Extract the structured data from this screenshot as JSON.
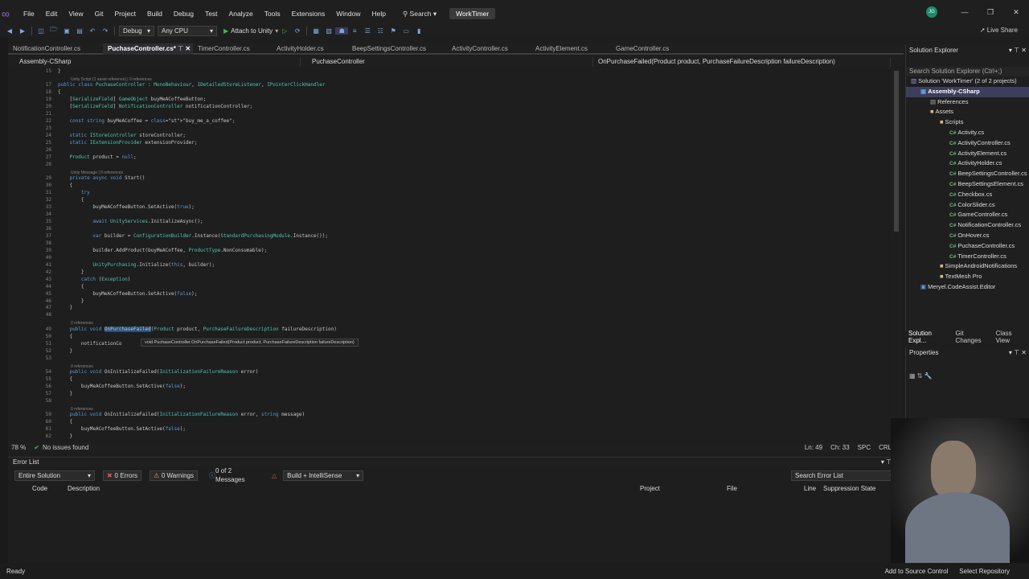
{
  "menu": [
    "File",
    "Edit",
    "View",
    "Git",
    "Project",
    "Build",
    "Debug",
    "Test",
    "Analyze",
    "Tools",
    "Extensions",
    "Window",
    "Help"
  ],
  "search_label": "Search",
  "project_name": "WorkTimer",
  "user_initials": "JG",
  "toolbar": {
    "config": "Debug",
    "platform": "Any CPU",
    "attach": "Attach to Unity",
    "live_share": "Live Share"
  },
  "tabs": [
    "NotificationController.cs",
    "PuchaseController.cs*",
    "TimerController.cs",
    "ActivityHolder.cs",
    "BeepSettingsController.cs",
    "ActivityController.cs",
    "ActivityElement.cs",
    "GameController.cs"
  ],
  "nav": {
    "project": "Assembly-CSharp",
    "class": "PuchaseController",
    "member": "OnPurchaseFailed(Product product, PurchaseFailureDescription failureDescription)"
  },
  "code_lines": [
    {
      "n": "15",
      "t": "}"
    },
    {
      "n": "",
      "hint": "Unity Script (1 asset reference) | 0 references"
    },
    {
      "n": "17",
      "t": "public class PuchaseController : MonoBehaviour, IDetailedStoreListener, IPointerClickHandler"
    },
    {
      "n": "18",
      "t": "{"
    },
    {
      "n": "19",
      "t": "    [SerializeField] GameObject buyMeACoffeeButton;"
    },
    {
      "n": "20",
      "t": "    [SerializeField] NotificationController notificationController;"
    },
    {
      "n": "21",
      "t": ""
    },
    {
      "n": "22",
      "t": "    const string buyMeACoffee = \"buy_me_a_coffee\";"
    },
    {
      "n": "23",
      "t": ""
    },
    {
      "n": "24",
      "t": "    static IStoreController storeController;"
    },
    {
      "n": "25",
      "t": "    static IExtensionProvider extensionProvider;"
    },
    {
      "n": "26",
      "t": ""
    },
    {
      "n": "27",
      "t": "    Product product = null;"
    },
    {
      "n": "28",
      "t": ""
    },
    {
      "n": "",
      "hint": "Unity Message | 0 references"
    },
    {
      "n": "29",
      "t": "    private async void Start()"
    },
    {
      "n": "30",
      "t": "    {"
    },
    {
      "n": "31",
      "t": "        try"
    },
    {
      "n": "32",
      "t": "        {"
    },
    {
      "n": "33",
      "t": "            buyMeACoffeeButton.SetActive(true);"
    },
    {
      "n": "34",
      "t": ""
    },
    {
      "n": "35",
      "t": "            await UnityServices.InitializeAsync();"
    },
    {
      "n": "36",
      "t": ""
    },
    {
      "n": "37",
      "t": "            var builder = ConfigurationBuilder.Instance(StandardPurchasingModule.Instance());"
    },
    {
      "n": "38",
      "t": ""
    },
    {
      "n": "39",
      "t": "            builder.AddProduct(buyMeACoffee, ProductType.NonConsumable);"
    },
    {
      "n": "40",
      "t": ""
    },
    {
      "n": "41",
      "t": "            UnityPurchasing.Initialize(this, builder);"
    },
    {
      "n": "42",
      "t": "        }"
    },
    {
      "n": "43",
      "t": "        catch (Exception)"
    },
    {
      "n": "44",
      "t": "        {"
    },
    {
      "n": "45",
      "t": "            buyMeACoffeeButton.SetActive(false);"
    },
    {
      "n": "46",
      "t": "        }"
    },
    {
      "n": "47",
      "t": "    }"
    },
    {
      "n": "48",
      "t": ""
    },
    {
      "n": "",
      "hint": "0 references"
    },
    {
      "n": "49",
      "t": "    public void OnPurchaseFailed(Product product, PurchaseFailureDescription failureDescription)"
    },
    {
      "n": "50",
      "t": "    {"
    },
    {
      "n": "51",
      "t": "        notificationCo"
    },
    {
      "n": "52",
      "t": "    }"
    },
    {
      "n": "53",
      "t": ""
    },
    {
      "n": "",
      "hint": "0 references"
    },
    {
      "n": "54",
      "t": "    public void OnInitializeFailed(InitializationFailureReason error)"
    },
    {
      "n": "55",
      "t": "    {"
    },
    {
      "n": "56",
      "t": "        buyMeACoffeeButton.SetActive(false);"
    },
    {
      "n": "57",
      "t": "    }"
    },
    {
      "n": "58",
      "t": ""
    },
    {
      "n": "",
      "hint": "0 references"
    },
    {
      "n": "59",
      "t": "    public void OnInitializeFailed(InitializationFailureReason error, string message)"
    },
    {
      "n": "60",
      "t": "    {"
    },
    {
      "n": "61",
      "t": "        buyMeACoffeeButton.SetActive(false);"
    },
    {
      "n": "62",
      "t": "    }"
    }
  ],
  "tooltip": "void PuchaseController.OnPurchaseFailed(Product product, PurchaseFailureDescription failureDescription)",
  "status": {
    "zoom": "78 %",
    "issues": "No issues found",
    "ln": "Ln: 49",
    "ch": "Ch: 33",
    "spc": "SPC",
    "crlf": "CRLF"
  },
  "errorlist": {
    "title": "Error List",
    "scope": "Entire Solution",
    "errors": "0 Errors",
    "warnings": "0 Warnings",
    "messages": "0 of 2 Messages",
    "build": "Build + IntelliSense",
    "search": "Search Error List",
    "cols": [
      "Code",
      "Description",
      "Project",
      "File",
      "Line",
      "Suppression State"
    ]
  },
  "solution": {
    "title": "Solution Explorer",
    "search": "Search Solution Explorer (Ctrl+;)",
    "items": [
      {
        "label": "Solution 'WorkTimer' (2 of 2 projects)",
        "depth": 0,
        "kind": "sln"
      },
      {
        "label": "Assembly-CSharp",
        "depth": 1,
        "kind": "proj",
        "sel": true
      },
      {
        "label": "References",
        "depth": 2,
        "kind": "ref"
      },
      {
        "label": "Assets",
        "depth": 2,
        "kind": "folder"
      },
      {
        "label": "Scripts",
        "depth": 3,
        "kind": "folder"
      },
      {
        "label": "Activity.cs",
        "depth": 4,
        "kind": "cs"
      },
      {
        "label": "ActivityController.cs",
        "depth": 4,
        "kind": "cs"
      },
      {
        "label": "ActivityElement.cs",
        "depth": 4,
        "kind": "cs"
      },
      {
        "label": "ActivityHolder.cs",
        "depth": 4,
        "kind": "cs"
      },
      {
        "label": "BeepSettingsController.cs",
        "depth": 4,
        "kind": "cs"
      },
      {
        "label": "BeepSettingsElement.cs",
        "depth": 4,
        "kind": "cs"
      },
      {
        "label": "Checkbox.cs",
        "depth": 4,
        "kind": "cs"
      },
      {
        "label": "ColorSlider.cs",
        "depth": 4,
        "kind": "cs"
      },
      {
        "label": "GameController.cs",
        "depth": 4,
        "kind": "cs"
      },
      {
        "label": "NotificationController.cs",
        "depth": 4,
        "kind": "cs"
      },
      {
        "label": "OnHover.cs",
        "depth": 4,
        "kind": "cs"
      },
      {
        "label": "PuchaseController.cs",
        "depth": 4,
        "kind": "cs"
      },
      {
        "label": "TimerController.cs",
        "depth": 4,
        "kind": "cs"
      },
      {
        "label": "SimpleAndroidNotifications",
        "depth": 3,
        "kind": "folder"
      },
      {
        "label": "TextMesh Pro",
        "depth": 3,
        "kind": "folder"
      },
      {
        "label": "Meryel.CodeAssist.Editor",
        "depth": 1,
        "kind": "proj"
      }
    ],
    "bottom_tabs": [
      "Solution Expl...",
      "Git Changes",
      "Class View"
    ]
  },
  "properties_title": "Properties",
  "bottom": {
    "ready": "Ready",
    "source": "Add to Source Control",
    "repo": "Select Repository"
  }
}
